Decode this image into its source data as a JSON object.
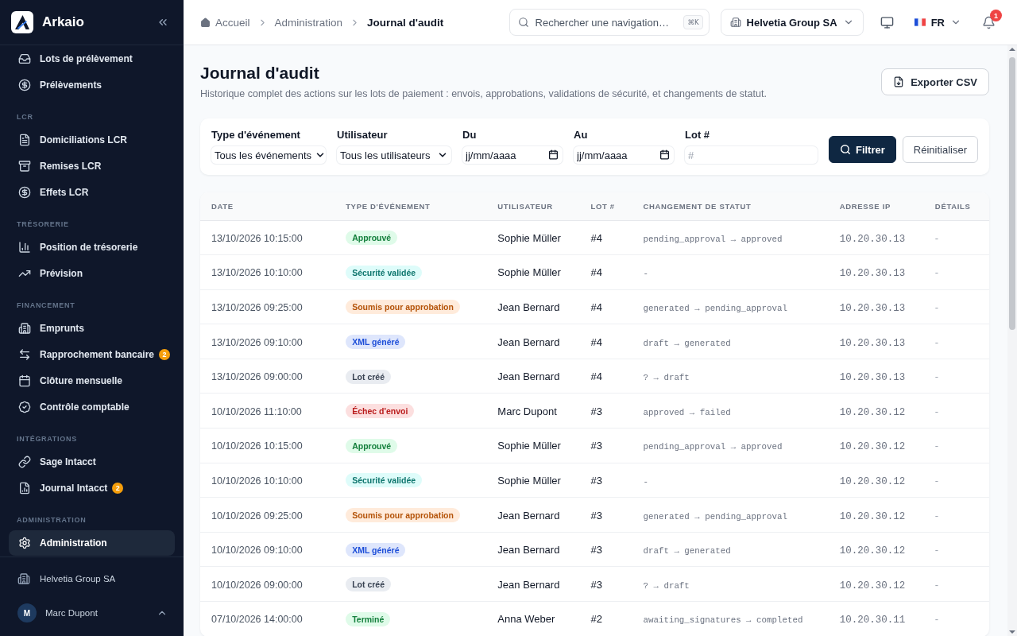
{
  "sidebar": {
    "brand": "Arkaio",
    "nav_groups": [
      {
        "items": [
          {
            "label": "Lots de prélèvement",
            "selected": false
          },
          {
            "label": "Prélèvements",
            "selected": false
          }
        ]
      },
      {
        "heading": "LCR",
        "items": [
          {
            "label": "Domiciliations LCR",
            "selected": false
          },
          {
            "label": "Remises LCR",
            "selected": false
          },
          {
            "label": "Effets LCR",
            "selected": false
          }
        ]
      },
      {
        "heading": "TRÉSORERIE",
        "items": [
          {
            "label": "Position de trésorerie",
            "selected": false
          },
          {
            "label": "Prévision",
            "selected": false
          }
        ]
      },
      {
        "heading": "FINANCEMENT",
        "items": [
          {
            "label": "Emprunts",
            "selected": false
          },
          {
            "label": "Rapprochement bancaire",
            "selected": false,
            "badge": "2"
          },
          {
            "label": "Clôture mensuelle",
            "selected": false
          },
          {
            "label": "Contrôle comptable",
            "selected": false
          }
        ]
      },
      {
        "heading": "INTÉGRATIONS",
        "items": [
          {
            "label": "Sage Intacct",
            "selected": false
          },
          {
            "label": "Journal Intacct",
            "selected": false,
            "badge": "2"
          }
        ]
      },
      {
        "heading": "ADMINISTRATION",
        "items": [
          {
            "label": "Administration",
            "selected": true
          }
        ]
      }
    ],
    "organization": "Helvetia Group SA",
    "user": {
      "initial": "M",
      "name": "Marc Dupont"
    }
  },
  "top_bar": {
    "breadcrumb": [
      "Accueil",
      "Administration",
      "Journal d'audit"
    ],
    "search": {
      "placeholder": "Rechercher une navigation…",
      "shortcut": "⌘K"
    },
    "organization_selector": "Helvetia Group SA",
    "language": "FR",
    "notification_count": "1"
  },
  "page": {
    "title": "Journal d'audit",
    "subtitle": "Historique complet des actions sur les lots de paiement : envois, approbations, validations de sécurité, et changements de statut.",
    "export_button": "Exporter CSV"
  },
  "filters": {
    "fields": [
      {
        "kind": "select",
        "label": "Type d'événement",
        "value": "Tous les événements"
      },
      {
        "kind": "select",
        "label": "Utilisateur",
        "value": "Tous les utilisateurs"
      },
      {
        "kind": "date",
        "label": "Du",
        "placeholder": "jj/mm/aaaa"
      },
      {
        "kind": "date",
        "label": "Au",
        "placeholder": "jj/mm/aaaa"
      },
      {
        "kind": "text",
        "label": "Lot #",
        "placeholder": "#"
      }
    ],
    "buttons": [
      {
        "kind": "primary",
        "label": "Filtrer"
      },
      {
        "kind": "secondary",
        "label": "Réinitialiser"
      }
    ]
  },
  "table": {
    "columns": [
      "DATE",
      "TYPE D'ÉVÉNEMENT",
      "UTILISATEUR",
      "LOT #",
      "CHANGEMENT DE STATUT",
      "ADRESSE IP",
      "DÉTAILS"
    ],
    "rows": [
      {
        "date": "13/10/2026 10:15:00",
        "event": {
          "label": "Approuvé",
          "color": "#15803d"
        },
        "user": "Sophie Müller",
        "lot": "#4",
        "status_change": "pending_approval → approved",
        "ip": "10.20.30.13",
        "details": "-"
      },
      {
        "date": "13/10/2026 10:10:00",
        "event": {
          "label": "Sécurité validée",
          "color": "#0f766e"
        },
        "user": "Sophie Müller",
        "lot": "#4",
        "status_change": "-",
        "ip": "10.20.30.13",
        "details": "-"
      },
      {
        "date": "13/10/2026 09:25:00",
        "event": {
          "label": "Soumis pour approbation",
          "color": "#b45309"
        },
        "user": "Jean Bernard",
        "lot": "#4",
        "status_change": "generated → pending_approval",
        "ip": "10.20.30.13",
        "details": "-"
      },
      {
        "date": "13/10/2026 09:10:00",
        "event": {
          "label": "XML généré",
          "color": "#1d4ed8"
        },
        "user": "Jean Bernard",
        "lot": "#4",
        "status_change": "draft → generated",
        "ip": "10.20.30.13",
        "details": "-"
      },
      {
        "date": "13/10/2026 09:00:00",
        "event": {
          "label": "Lot créé",
          "color": "#374151"
        },
        "user": "Jean Bernard",
        "lot": "#4",
        "status_change": "? → draft",
        "ip": "10.20.30.13",
        "details": "-"
      },
      {
        "date": "10/10/2026 11:10:00",
        "event": {
          "label": "Échec d'envoi",
          "color": "#b91c1c"
        },
        "user": "Marc Dupont",
        "lot": "#3",
        "status_change": "approved → failed",
        "ip": "10.20.30.12",
        "details": "-"
      },
      {
        "date": "10/10/2026 10:15:00",
        "event": {
          "label": "Approuvé",
          "color": "#15803d"
        },
        "user": "Sophie Müller",
        "lot": "#3",
        "status_change": "pending_approval → approved",
        "ip": "10.20.30.12",
        "details": "-"
      },
      {
        "date": "10/10/2026 10:10:00",
        "event": {
          "label": "Sécurité validée",
          "color": "#0f766e"
        },
        "user": "Sophie Müller",
        "lot": "#3",
        "status_change": "-",
        "ip": "10.20.30.12",
        "details": "-"
      },
      {
        "date": "10/10/2026 09:25:00",
        "event": {
          "label": "Soumis pour approbation",
          "color": "#b45309"
        },
        "user": "Jean Bernard",
        "lot": "#3",
        "status_change": "generated → pending_approval",
        "ip": "10.20.30.12",
        "details": "-"
      },
      {
        "date": "10/10/2026 09:10:00",
        "event": {
          "label": "XML généré",
          "color": "#1d4ed8"
        },
        "user": "Jean Bernard",
        "lot": "#3",
        "status_change": "draft → generated",
        "ip": "10.20.30.12",
        "details": "-"
      },
      {
        "date": "10/10/2026 09:00:00",
        "event": {
          "label": "Lot créé",
          "color": "#374151"
        },
        "user": "Jean Bernard",
        "lot": "#3",
        "status_change": "? → draft",
        "ip": "10.20.30.12",
        "details": "-"
      },
      {
        "date": "07/10/2026 14:00:00",
        "event": {
          "label": "Terminé",
          "color": "#15803d"
        },
        "user": "Anna Weber",
        "lot": "#2",
        "status_change": "awaiting_signatures → completed",
        "ip": "10.20.30.11",
        "details": "-"
      }
    ]
  }
}
